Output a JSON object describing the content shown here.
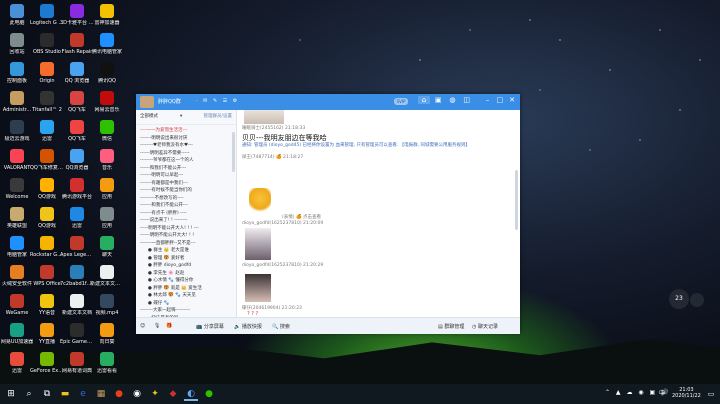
{
  "desktop_icons": [
    {
      "label": "此电脑",
      "color": "#4a90d9",
      "icon": "computer-icon"
    },
    {
      "label": "Logitech G HUB",
      "color": "#1c7bd1",
      "icon": "logitech-icon"
    },
    {
      "label": "3D卡雅平台 2.0",
      "color": "#8a2be2",
      "icon": "3d-icon"
    },
    {
      "label": "雷神加速器",
      "color": "#f2c200",
      "icon": "thunder-icon"
    },
    {
      "label": "回收站",
      "color": "#7f8c8d",
      "icon": "recycle-bin-icon"
    },
    {
      "label": "OBS Studio",
      "color": "#2b2b2b",
      "icon": "obs-icon"
    },
    {
      "label": "Flash Repair",
      "color": "#c0392b",
      "icon": "flash-icon"
    },
    {
      "label": "腾讯电脑管家",
      "color": "#1e90ff",
      "icon": "tencent-manager-icon"
    },
    {
      "label": "控制面板",
      "color": "#3498db",
      "icon": "control-panel-icon"
    },
    {
      "label": "Origin",
      "color": "#f56c2d",
      "icon": "origin-icon"
    },
    {
      "label": "QQ 浏览器",
      "color": "#4aa3f0",
      "icon": "qq-browser-icon"
    },
    {
      "label": "腾讯QQ",
      "color": "#111111",
      "icon": "qq-icon"
    },
    {
      "label": "Administr...",
      "color": "#c59d5f",
      "icon": "user-folder-icon"
    },
    {
      "label": "Titanfall™ 2",
      "color": "#333333",
      "icon": "titanfall-icon"
    },
    {
      "label": "QQ飞车",
      "color": "#d64541",
      "icon": "qq-speed-icon"
    },
    {
      "label": "网易云音乐",
      "color": "#c20c0c",
      "icon": "netease-music-icon"
    },
    {
      "label": "极迈云游戏",
      "color": "#2c3e50",
      "icon": "cloud-game-icon"
    },
    {
      "label": "迅雷",
      "color": "#2ba4ef",
      "icon": "thunder-download-icon"
    },
    {
      "label": "QQ飞车",
      "color": "#e44",
      "icon": "qq-speed-icon"
    },
    {
      "label": "微信",
      "color": "#2dc100",
      "icon": "wechat-icon"
    },
    {
      "label": "VALORANT",
      "color": "#fa4454",
      "icon": "valorant-icon"
    },
    {
      "label": "QQ飞车修复工具",
      "color": "#d35400",
      "icon": "repair-tool-icon"
    },
    {
      "label": "QQ浏览器",
      "color": "#4aa3f0",
      "icon": "qq-browser-icon"
    },
    {
      "label": "音乐",
      "color": "#ff5e7e",
      "icon": "music-icon"
    },
    {
      "label": "Welcome",
      "color": "#3a3a3a",
      "icon": "welcome-icon"
    },
    {
      "label": "QQ游戏",
      "color": "#ffb300",
      "icon": "qq-game-icon"
    },
    {
      "label": "腾讯游戏平台",
      "color": "#d32f2f",
      "icon": "tencent-game-icon"
    },
    {
      "label": "应用",
      "color": "#f39c12",
      "icon": "apps-icon"
    },
    {
      "label": "英雄联盟",
      "color": "#c8aa6e",
      "icon": "lol-icon"
    },
    {
      "label": "QQ游戏",
      "color": "#f0c419",
      "icon": "qq-game-icon"
    },
    {
      "label": "迅雷",
      "color": "#1e88e5",
      "icon": "thunder-download-icon"
    },
    {
      "label": "应用",
      "color": "#7f8c8d",
      "icon": "apps-icon"
    },
    {
      "label": "电脑管家",
      "color": "#1e90ff",
      "icon": "pc-manager-icon"
    },
    {
      "label": "Rockstar Games...",
      "color": "#f4b400",
      "icon": "rockstar-icon"
    },
    {
      "label": "Apex Legends",
      "color": "#c0392b",
      "icon": "apex-icon"
    },
    {
      "label": "聊天",
      "color": "#27ae60",
      "icon": "chat-icon"
    },
    {
      "label": "火绒安全软件",
      "color": "#e67e22",
      "icon": "huorong-icon"
    },
    {
      "label": "WPS Office",
      "color": "#c0392b",
      "icon": "wps-icon"
    },
    {
      "label": "7c2babd1fb...",
      "color": "#2980b9",
      "icon": "file-icon"
    },
    {
      "label": "新建文本文档.txt",
      "color": "#ecf0f1",
      "icon": "text-file-icon"
    },
    {
      "label": "WeGame",
      "color": "#c0392b",
      "icon": "wegame-icon"
    },
    {
      "label": "YY语音",
      "color": "#f1c40f",
      "icon": "yy-icon"
    },
    {
      "label": "新建文本文档",
      "color": "#ecf0f1",
      "icon": "text-file-icon"
    },
    {
      "label": "视频.mp4",
      "color": "#34495e",
      "icon": "video-file-icon"
    },
    {
      "label": "网易UU加速器",
      "color": "#16a085",
      "icon": "uu-icon"
    },
    {
      "label": "YY直播",
      "color": "#f39c12",
      "icon": "yy-live-icon"
    },
    {
      "label": "Epic Games Launcher",
      "color": "#2c2c2c",
      "icon": "epic-icon"
    },
    {
      "label": "向日葵",
      "color": "#f39c12",
      "icon": "sunflower-icon"
    },
    {
      "label": "迅雷",
      "color": "#e74c3c",
      "icon": "thunder-download-icon"
    },
    {
      "label": "GeForce Experience",
      "color": "#76b900",
      "icon": "geforce-icon"
    },
    {
      "label": "网易有道词典",
      "color": "#c0392b",
      "icon": "youdao-icon"
    },
    {
      "label": "迅雷看看",
      "color": "#27ae60",
      "icon": "thunder-video-icon"
    }
  ],
  "qq_window": {
    "title_name": "胖胖QQ群",
    "title_sub": "2019/9/15",
    "svip_label": "SVIP",
    "left_panel": {
      "mode": "全部模式",
      "filter": "▾",
      "manage": "管理群员/设置",
      "rows": [
        {
          "text": "----一一为爱而生活活---",
          "cls": "red"
        },
        {
          "text": "-------明明说出来很讨厌",
          "cls": ""
        },
        {
          "text": "--------♥老师我没有水♥---",
          "cls": ""
        },
        {
          "text": "------明明差异不需要-----",
          "cls": ""
        },
        {
          "text": "--------爷爷都在这一个的人",
          "cls": ""
        },
        {
          "text": "------和我们不能公开---",
          "cls": ""
        },
        {
          "text": "-------明明可以早起---",
          "cls": ""
        },
        {
          "text": "-------有趣都是中我们---",
          "cls": ""
        },
        {
          "text": "-------有时候不能当你们的",
          "cls": ""
        },
        {
          "text": "---------不想改写的----",
          "cls": ""
        },
        {
          "text": "-------和我们不能公开---",
          "cls": ""
        },
        {
          "text": "-------有点干 (胖胖) ----",
          "cls": ""
        },
        {
          "text": "------说出来了! ! --------",
          "cls": ""
        },
        {
          "text": "-----明明不能公开大人! ! ! ---",
          "cls": ""
        },
        {
          "text": "------明明不能公开大大! ! !",
          "cls": ""
        },
        {
          "text": "-------一直都胖胖--又不是---",
          "cls": ""
        },
        {
          "text": "● 群主 👑 老大是谁",
          "cls": "mem"
        },
        {
          "text": "● 管理 🐯 爱好者",
          "cls": "mem"
        },
        {
          "text": "● 胖胖 dioyo_godfd",
          "cls": "mem"
        },
        {
          "text": "● 李先生 🌸 赵赵",
          "cls": "mem"
        },
        {
          "text": "● 心水情 🐾 懂得分你",
          "cls": "mem"
        },
        {
          "text": "● 胖胖 🐯 就是 👑 爱生活",
          "cls": "mem"
        },
        {
          "text": "● 林太郎 🐯 🐾 天天见",
          "cls": "mem"
        },
        {
          "text": "● 碟仔 🐾",
          "cls": "mem"
        },
        {
          "text": "--------大家一起嗨---------",
          "cls": ""
        },
        {
          "text": "-------快乐是有的吗----------",
          "cls": ""
        },
        {
          "text": "--------有说一说三的事---------",
          "cls": ""
        }
      ]
    },
    "chat": {
      "msg1_meta": "睡眠骑士(2455162) 21:18:33",
      "pinned": "贝贝---我明友朋边在等我哈",
      "notice": "通知: 管理员 (dioyo_god45) 已经将你设置为 血来管理, 只有管理员可以查看. 【电报群, 同城需要公用服务规则】",
      "msg2_meta": "屎王(7487714) 🍊 21:18:27",
      "msg3_caption": "(表情)  🍊 点击查看",
      "msg4_meta": "dioyo_godfd(1625237810) 21:20:09",
      "msg5_meta": "dioyo_godfd(1625237810) 21:20:29",
      "msg6_meta": "碟仔(204619904) 21:20:23",
      "msg6_text": "? ? ?"
    },
    "toolbar": {
      "gift": "🎁",
      "audio_label": "分享屏幕",
      "video_label": "播放快报",
      "search_label": "搜索",
      "msg_manage": "群聊管理",
      "history": "聊天记录"
    }
  },
  "clock_widget": {
    "value": "23"
  },
  "taskbar": {
    "start": "⊞",
    "time": "21:03",
    "date": "2020/11/22",
    "lang": "中"
  }
}
